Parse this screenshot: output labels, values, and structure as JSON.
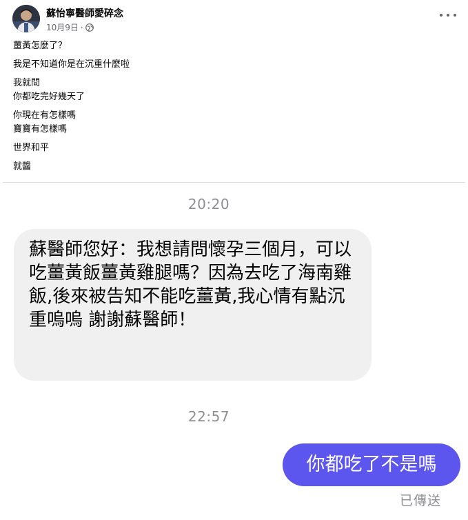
{
  "post": {
    "author": "蘇怡寧醫師愛碎念",
    "date": "10月9日",
    "separator": "·",
    "visibility_icon": "globe-icon",
    "more_icon": "more-options-icon",
    "lines": [
      "薑黃怎麼了？",
      "我是不知道你是在沉重什麼啦",
      "我就問",
      "你都吃完好幾天了",
      "你現在有怎樣嗎",
      "寶寶有怎樣嗎",
      "世界和平",
      "就醬"
    ]
  },
  "chat": {
    "timestamp_1": "20:20",
    "incoming_message": "蘇醫師您好：我想請問懷孕三個月，可以吃薑黃飯薑黃雞腿嗎？因為去吃了海南雞飯,後來被告知不能吃薑黃,我心情有點沉重嗚嗚 謝謝蘇醫師！",
    "timestamp_2": "22:57",
    "outgoing_message": "你都吃了不是嗎",
    "sent_status": "已傳送"
  },
  "colors": {
    "outgoing_bubble": "#5c55ee",
    "incoming_bubble": "#f0f0f0",
    "meta_gray": "#65676b",
    "timestamp_gray": "#8e8e93"
  }
}
